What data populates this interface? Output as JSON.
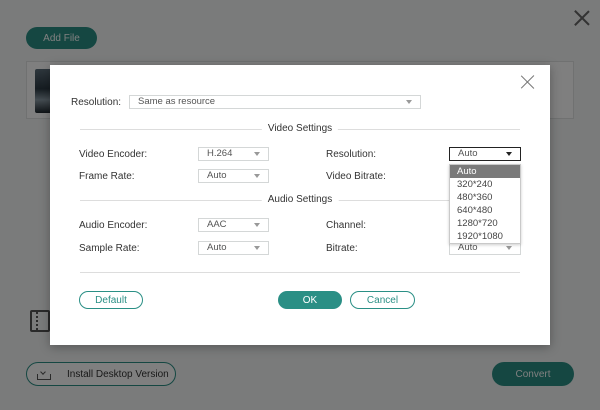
{
  "app": {
    "add_file_label": "Add File",
    "install_label": "Install Desktop Version",
    "convert_label": "Convert"
  },
  "modal": {
    "resolution_top": {
      "label": "Resolution:",
      "value": "Same as resource"
    },
    "video_section_title": "Video Settings",
    "video": {
      "encoder": {
        "label": "Video Encoder:",
        "value": "H.264"
      },
      "frame_rate": {
        "label": "Frame Rate:",
        "value": "Auto"
      },
      "resolution": {
        "label": "Resolution:",
        "value": "Auto"
      },
      "bitrate": {
        "label": "Video Bitrate:"
      }
    },
    "audio_section_title": "Audio Settings",
    "audio": {
      "encoder": {
        "label": "Audio Encoder:",
        "value": "AAC"
      },
      "sample_rate": {
        "label": "Sample Rate:",
        "value": "Auto"
      },
      "channel": {
        "label": "Channel:"
      },
      "bitrate": {
        "label": "Bitrate:",
        "value": "Auto"
      }
    },
    "buttons": {
      "default": "Default",
      "ok": "OK",
      "cancel": "Cancel"
    },
    "resolution_dropdown": {
      "options": [
        "Auto",
        "320*240",
        "480*360",
        "640*480",
        "1280*720",
        "1920*1080"
      ],
      "selected": "Auto"
    }
  },
  "colors": {
    "accent": "#2a8f85",
    "overlay": "rgba(0,0,0,0.5)",
    "dropdown_selected": "#7a7a7a"
  }
}
